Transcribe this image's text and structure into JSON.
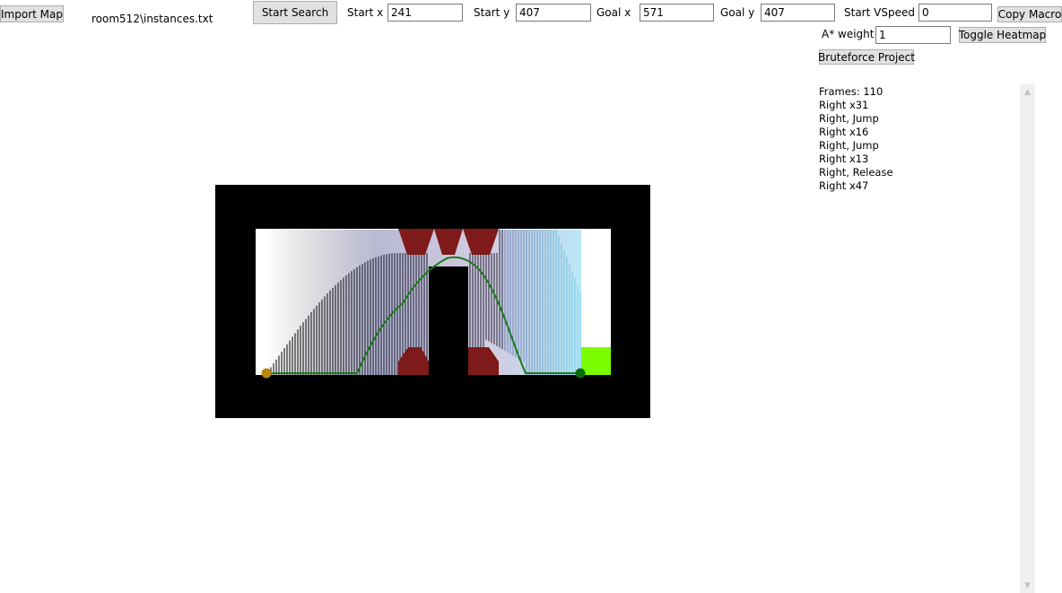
{
  "toolbar": {
    "import_label": "Import Map",
    "file_path": "room512\\instances.txt",
    "start_search_label": "Start Search",
    "start_x_label": "Start x",
    "start_x_value": "241",
    "start_y_label": "Start y",
    "start_y_value": "407",
    "goal_x_label": "Goal x",
    "goal_x_value": "571",
    "goal_y_label": "Goal y",
    "goal_y_value": "407",
    "start_vspeed_label": "Start VSpeed",
    "start_vspeed_value": "0",
    "copy_macro_label": "Copy Macro",
    "astar_weight_label": "A* weight",
    "astar_weight_value": "1",
    "toggle_heatmap_label": "Toggle Heatmap",
    "bruteforce_label": "Bruteforce Project"
  },
  "log": {
    "lines": [
      "Frames: 110",
      "Right x31",
      "Right, Jump",
      "Right x16",
      "Right, Jump",
      "Right x13",
      "Right, Release",
      "Right x47"
    ]
  },
  "colors": {
    "wall": "#000000",
    "spike": "#7f1a1a",
    "goal_block": "#7cfc00",
    "path": "#1a7a1a",
    "start_marker": "#b8860b",
    "goal_marker": "#0a6a0a"
  }
}
